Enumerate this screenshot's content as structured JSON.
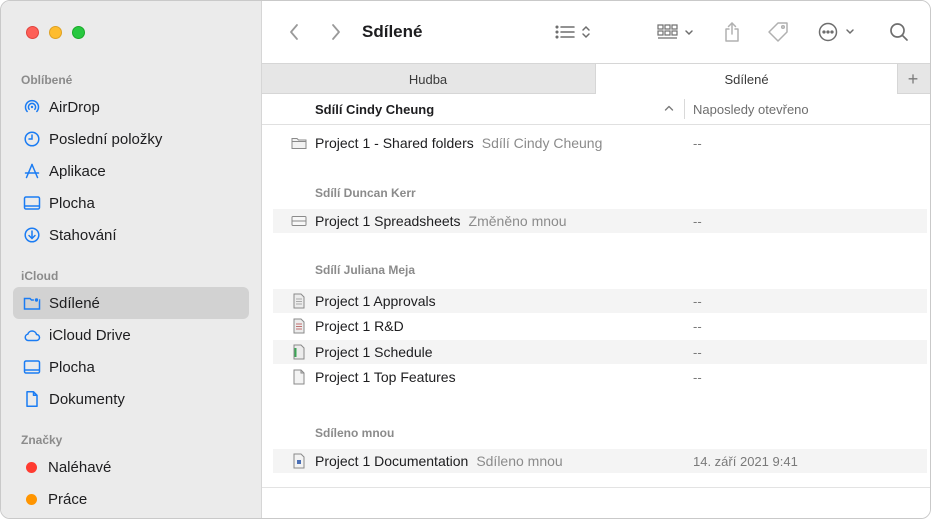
{
  "sidebar": {
    "sections": {
      "favorites": "Oblíbené",
      "icloud": "iCloud",
      "tags": "Značky"
    },
    "favorites": [
      {
        "label": "AirDrop",
        "icon": "airdrop-icon"
      },
      {
        "label": "Poslední položky",
        "icon": "clock-icon"
      },
      {
        "label": "Aplikace",
        "icon": "applications-icon"
      },
      {
        "label": "Plocha",
        "icon": "desktop-icon"
      },
      {
        "label": "Stahování",
        "icon": "download-icon"
      }
    ],
    "icloud": [
      {
        "label": "Sdílené",
        "icon": "shared-folder-icon",
        "selected": true
      },
      {
        "label": "iCloud Drive",
        "icon": "cloud-icon"
      },
      {
        "label": "Plocha",
        "icon": "desktop-icon"
      },
      {
        "label": "Dokumenty",
        "icon": "document-icon"
      }
    ],
    "tags": [
      {
        "label": "Naléhavé",
        "color": "#ff3b30"
      },
      {
        "label": "Práce",
        "color": "#ff9500"
      }
    ]
  },
  "toolbar": {
    "title": "Sdílené"
  },
  "tabs": {
    "items": [
      "Hudba",
      "Sdílené"
    ],
    "active": "Sdílené",
    "add_label": "+"
  },
  "columns": {
    "name": "Sdílí Cindy Cheung",
    "date": "Naposledy otevřeno"
  },
  "groups": {
    "duncan": "Sdílí Duncan Kerr",
    "juliana": "Sdílí Juliana Meja",
    "me": "Sdíleno mnou"
  },
  "files": [
    {
      "name": "Project 1 - Shared folders",
      "sub": "Sdílí Cindy Cheung",
      "date": "--",
      "icon": "folder-icon"
    },
    {
      "name": "Project 1 Spreadsheets",
      "sub": "Změněno mnou",
      "date": "--",
      "icon": "spreadsheet-icon"
    },
    {
      "name": "Project 1 Approvals",
      "sub": "",
      "date": "--",
      "icon": "document-file-icon"
    },
    {
      "name": "Project 1 R&D",
      "sub": "",
      "date": "--",
      "icon": "document-file-icon"
    },
    {
      "name": "Project 1 Schedule",
      "sub": "",
      "date": "--",
      "icon": "numbers-file-icon"
    },
    {
      "name": "Project 1 Top Features",
      "sub": "",
      "date": "--",
      "icon": "document-file-icon"
    },
    {
      "name": "Project 1 Documentation",
      "sub": "Sdíleno mnou",
      "date": "14. září 2021 9:41",
      "icon": "pages-file-icon"
    }
  ],
  "colors": {
    "accent": "#1b7cf3",
    "sidebar_bg": "#ebebeb",
    "selected_bg": "#d2d2d2"
  }
}
